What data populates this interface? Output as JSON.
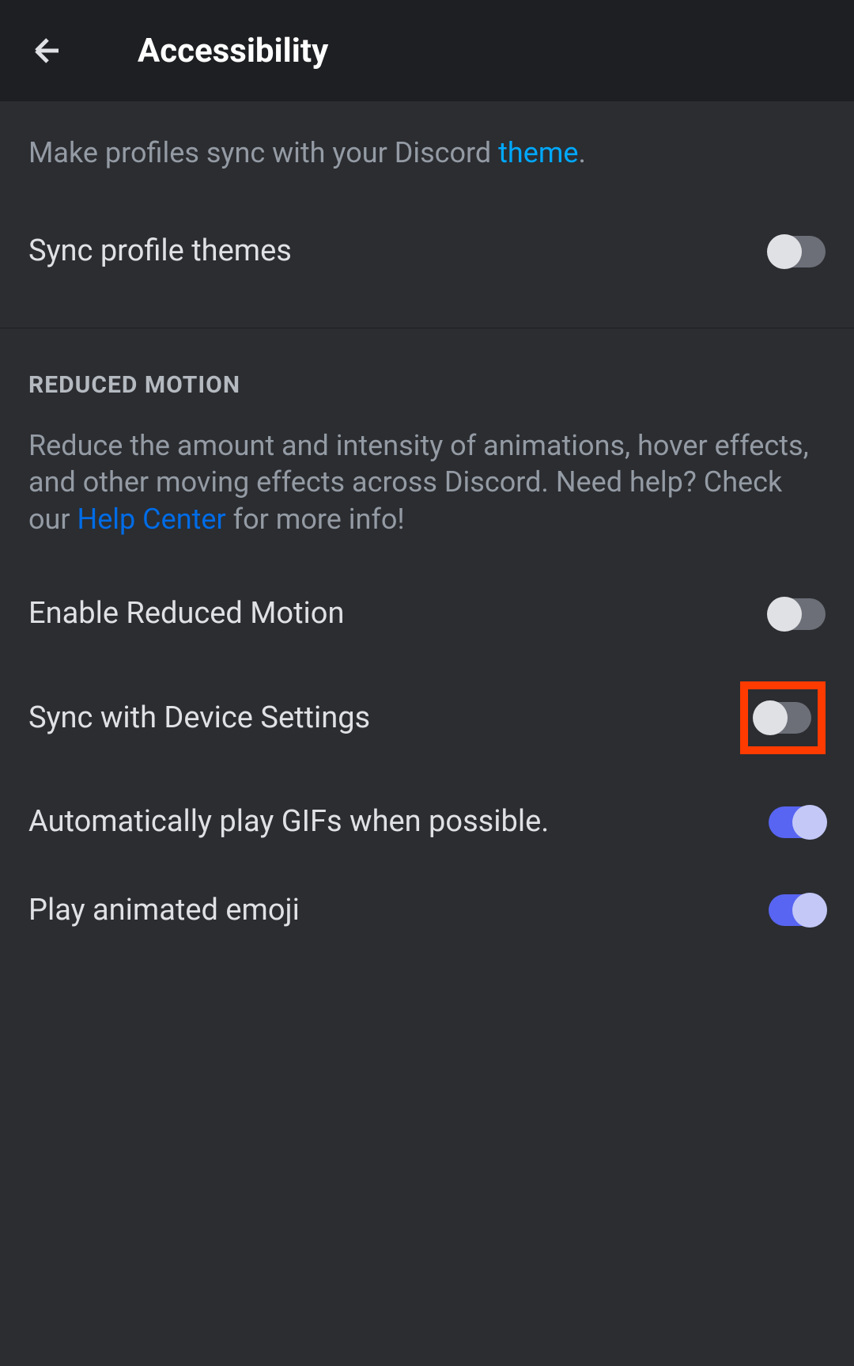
{
  "header": {
    "title": "Accessibility"
  },
  "profileSection": {
    "description_prefix": "Make profiles sync with your Discord ",
    "description_link": "theme",
    "description_suffix": ".",
    "syncProfileThemes": {
      "label": "Sync profile themes",
      "enabled": false
    }
  },
  "reducedMotionSection": {
    "header": "REDUCED MOTION",
    "description_part1": "Reduce the amount and intensity of animations, hover effects, and other moving effects across Discord. Need help? Check our ",
    "description_link": "Help Center",
    "description_part2": " for more info!",
    "enableReducedMotion": {
      "label": "Enable Reduced Motion",
      "enabled": false
    },
    "syncWithDevice": {
      "label": "Sync with Device Settings",
      "enabled": false,
      "highlighted": true
    },
    "autoPlayGifs": {
      "label": "Automatically play GIFs when possible.",
      "enabled": true
    },
    "playAnimatedEmoji": {
      "label": "Play animated emoji",
      "enabled": true
    }
  }
}
